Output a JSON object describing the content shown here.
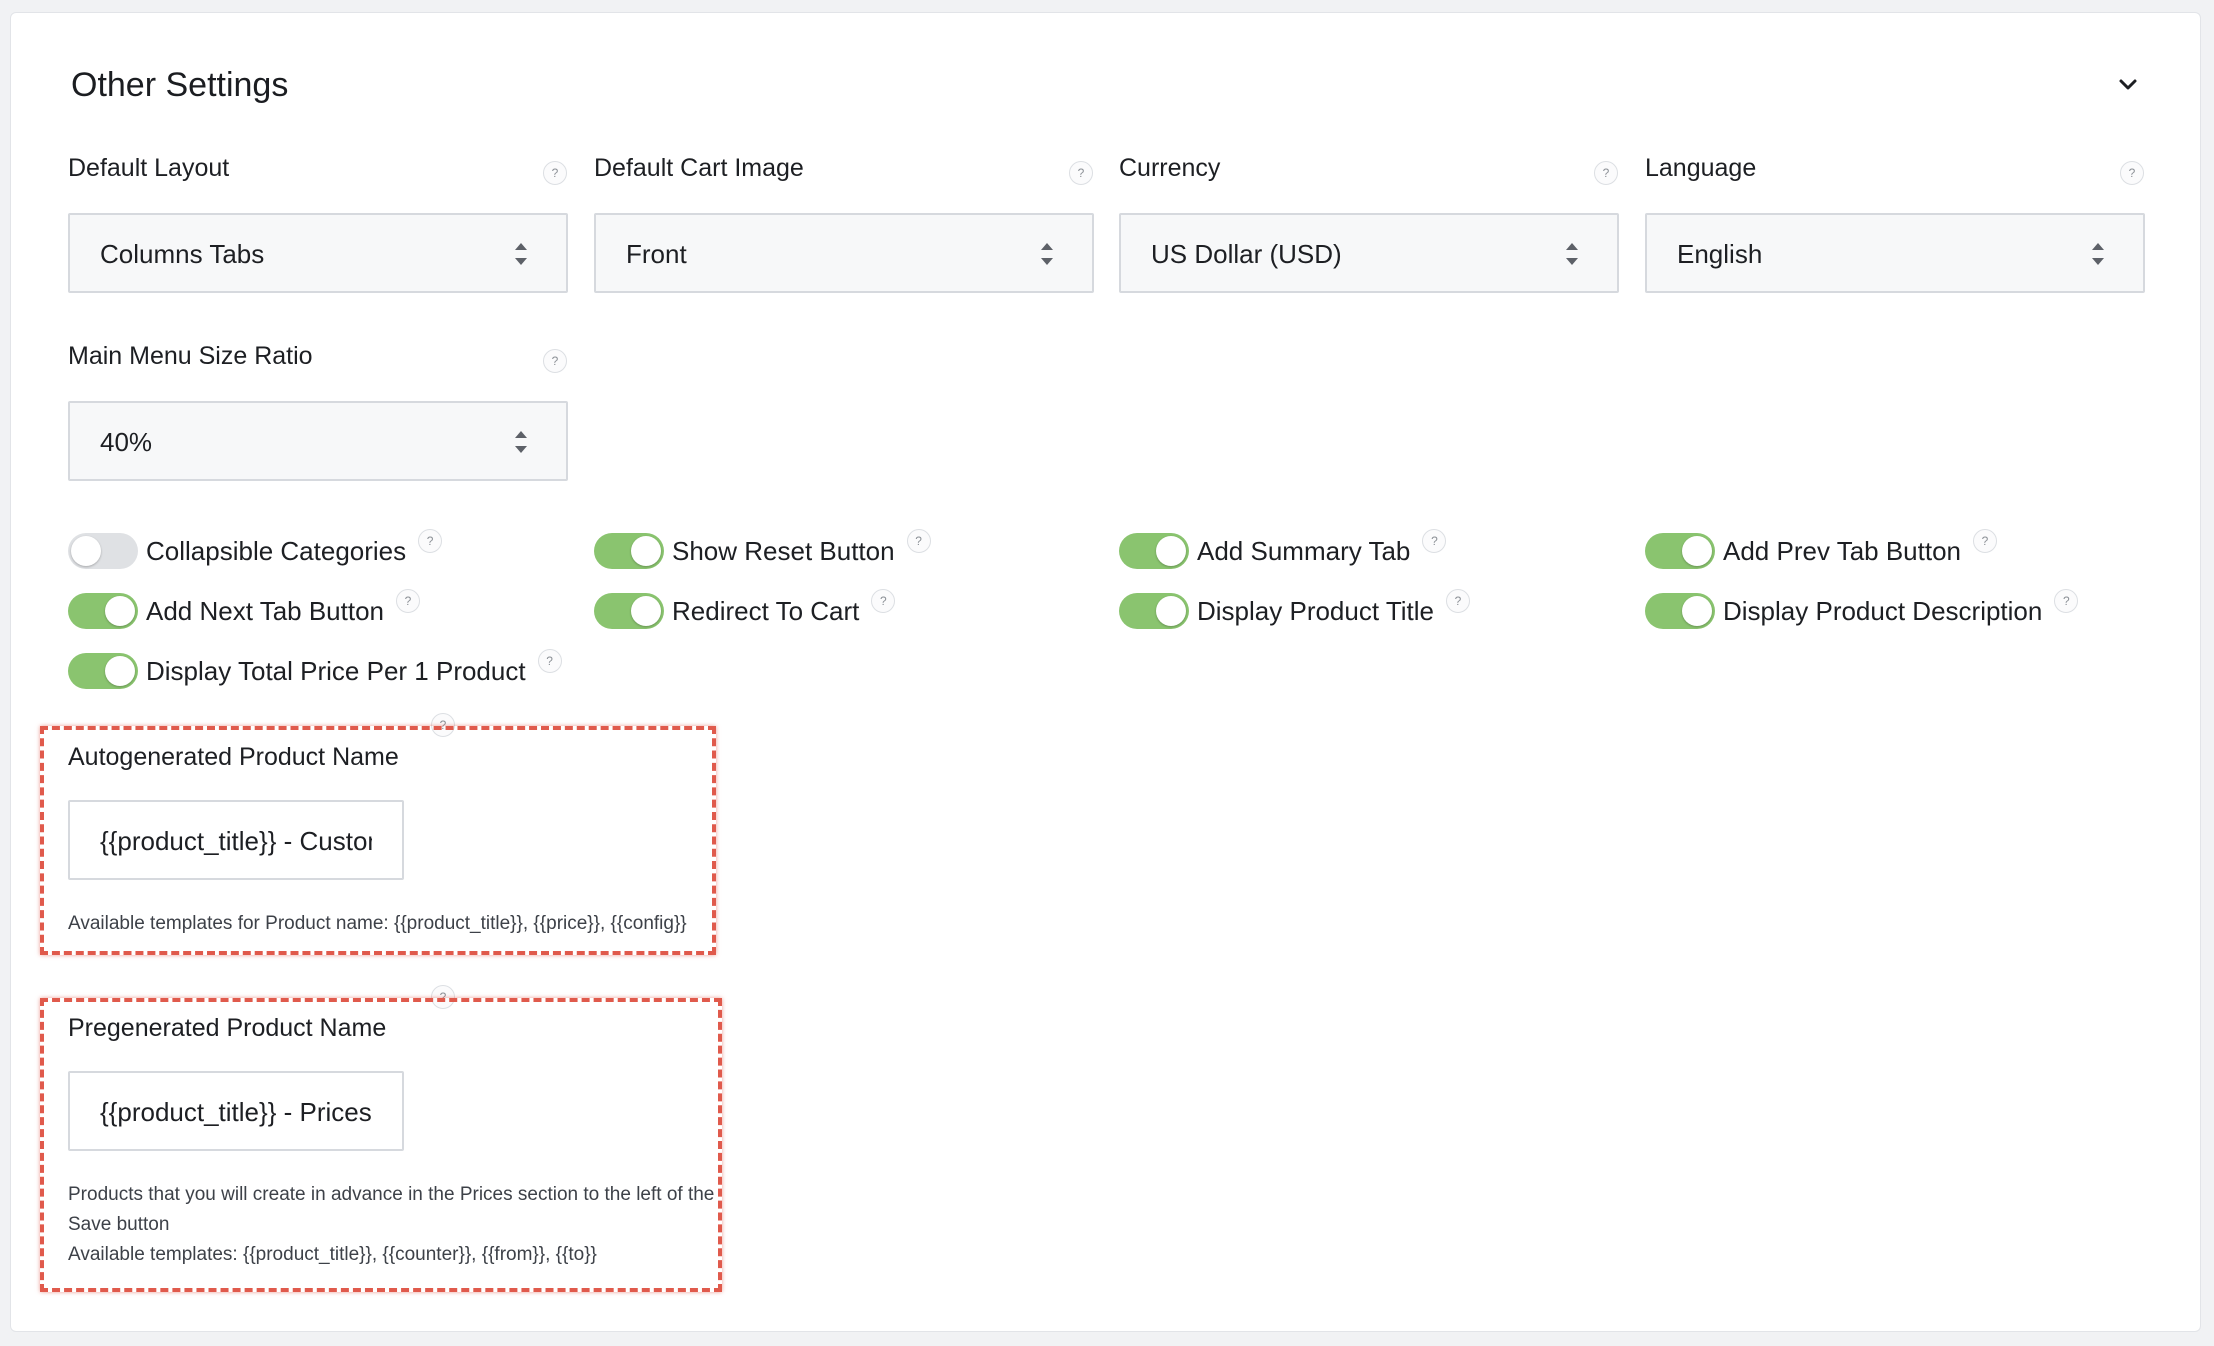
{
  "section": {
    "title": "Other Settings",
    "collapse_icon": "chevron-down-icon"
  },
  "help_symbol": "?",
  "selects": {
    "default_layout": {
      "label": "Default Layout",
      "value": "Columns Tabs"
    },
    "default_cart_image": {
      "label": "Default Cart Image",
      "value": "Front"
    },
    "currency": {
      "label": "Currency",
      "value": "US Dollar (USD)"
    },
    "language": {
      "label": "Language",
      "value": "English"
    },
    "main_menu_size_ratio": {
      "label": "Main Menu Size Ratio",
      "value": "40%"
    }
  },
  "toggles": {
    "collapsible_categories": {
      "label": "Collapsible Categories",
      "on": false
    },
    "show_reset_button": {
      "label": "Show Reset Button",
      "on": true
    },
    "add_summary_tab": {
      "label": "Add Summary Tab",
      "on": true
    },
    "add_prev_tab_button": {
      "label": "Add Prev Tab Button",
      "on": true
    },
    "add_next_tab_button": {
      "label": "Add Next Tab Button",
      "on": true
    },
    "redirect_to_cart": {
      "label": "Redirect To Cart",
      "on": true
    },
    "display_product_title": {
      "label": "Display Product Title",
      "on": true
    },
    "display_product_description": {
      "label": "Display Product Description",
      "on": true
    },
    "display_total_price": {
      "label": "Display Total Price Per 1 Product",
      "on": true
    }
  },
  "autogenerated": {
    "label": "Autogenerated Product Name",
    "value": "{{product_title}} - Custon",
    "hint": "Available templates for Product name: {{product_title}}, {{price}}, {{config}}"
  },
  "pregenerated": {
    "label": "Pregenerated Product Name",
    "value": "{{product_title}} - Prices f",
    "hint_line1": "Products that you will create in advance in the Prices section to the left of the",
    "hint_line2": "Save button",
    "hint_line3": "Available templates: {{product_title}}, {{counter}}, {{from}}, {{to}}"
  },
  "colors": {
    "toggle_on": "#8ac46f",
    "toggle_off": "#dfe1e4",
    "highlight": "#e05a4c"
  }
}
